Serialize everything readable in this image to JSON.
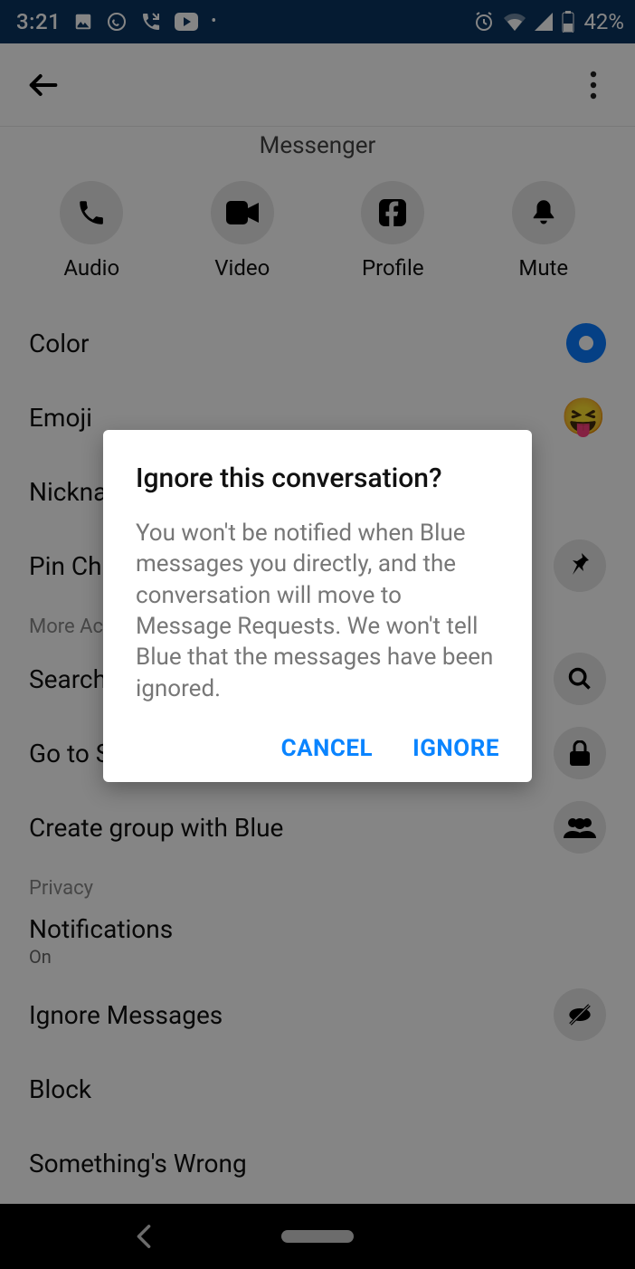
{
  "status": {
    "time": "3:21",
    "battery": "42%"
  },
  "subheader": "Messenger",
  "actions": {
    "audio": "Audio",
    "video": "Video",
    "profile": "Profile",
    "mute": "Mute"
  },
  "rows": {
    "color": "Color",
    "emoji": "Emoji",
    "nicknames": "Nicknames",
    "pin": "Pin Chat",
    "search": "Search in Conversation",
    "secret": "Go to Secret Conversation",
    "create_group": "Create group with Blue",
    "notifications_title": "Notifications",
    "notifications_sub": "On",
    "ignore": "Ignore Messages",
    "block": "Block",
    "wrong": "Something's Wrong"
  },
  "sections": {
    "more": "More Actions",
    "privacy": "Privacy"
  },
  "emoji_glyph": "😝",
  "dialog": {
    "title": "Ignore this conversation?",
    "body": "You won't be notified when Blue messages you directly, and the conversation will move to Message Requests. We won't tell Blue that the messages have been ignored.",
    "cancel": "CANCEL",
    "ignore": "IGNORE"
  }
}
